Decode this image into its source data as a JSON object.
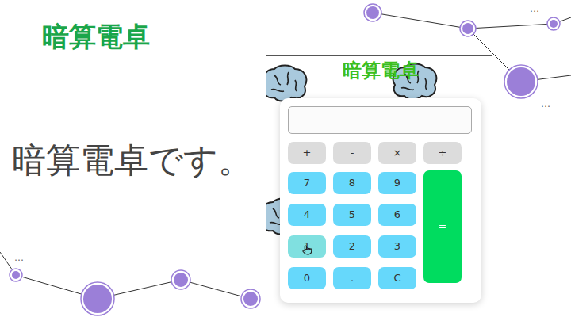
{
  "slide": {
    "title": "暗算電卓",
    "body": "暗算電卓です。"
  },
  "decoration": {
    "marks": [
      "…",
      "…",
      "…"
    ]
  },
  "app": {
    "heading": "暗算電卓",
    "display": {
      "value": ""
    },
    "operators": [
      "+",
      "-",
      "×",
      "÷"
    ],
    "keys": [
      {
        "label": "7",
        "hovered": false
      },
      {
        "label": "8",
        "hovered": false
      },
      {
        "label": "9",
        "hovered": false
      },
      {
        "label": "4",
        "hovered": false
      },
      {
        "label": "5",
        "hovered": false
      },
      {
        "label": "6",
        "hovered": false
      },
      {
        "label": "1",
        "hovered": true
      },
      {
        "label": "2",
        "hovered": false
      },
      {
        "label": "3",
        "hovered": false
      },
      {
        "label": "0",
        "hovered": false
      },
      {
        "label": ".",
        "hovered": false
      },
      {
        "label": "C",
        "hovered": false
      }
    ],
    "equals": "="
  }
}
